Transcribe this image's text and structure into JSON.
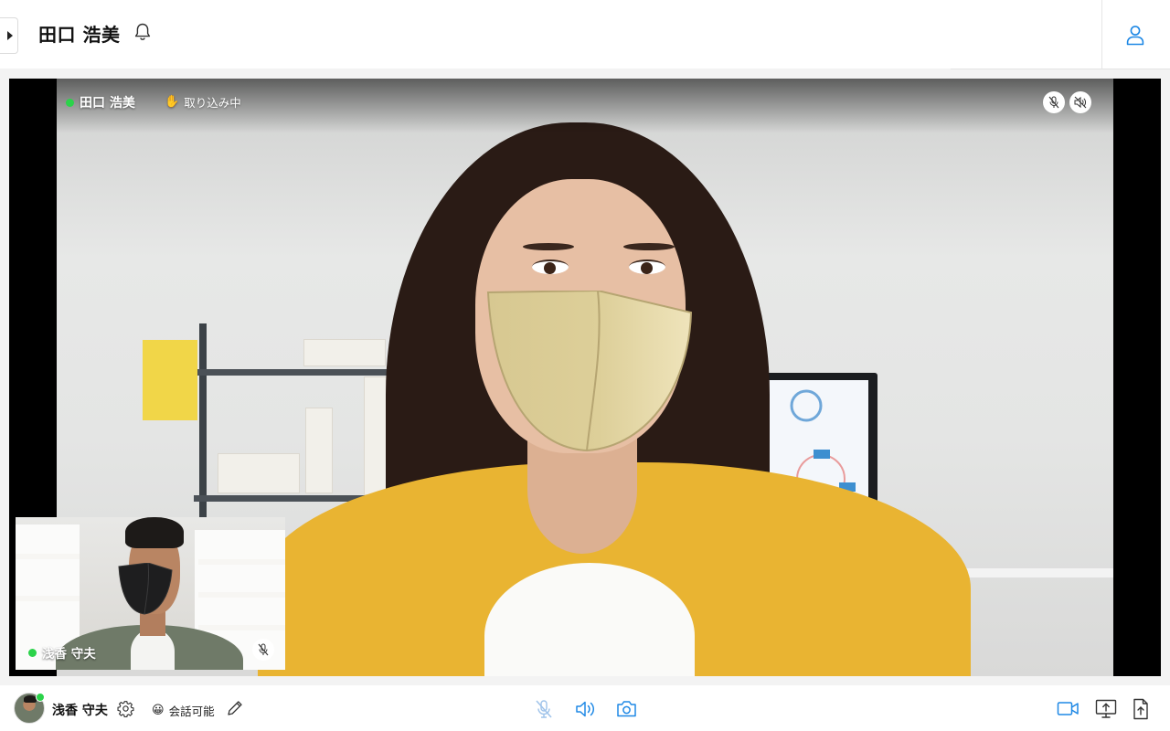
{
  "header": {
    "title": "田口 浩美"
  },
  "main_video": {
    "participant_name": "田口 浩美",
    "status_emoji": "✋",
    "status_text": "取り込み中"
  },
  "self_view": {
    "participant_name": "浅香 守夫"
  },
  "footer": {
    "user_name": "浅香 守夫",
    "status_emoji": "😀",
    "status_text": "会話可能"
  },
  "colors": {
    "accent": "#1e88e5",
    "online": "#2bd34a",
    "muted_icon": "#9fc3ea"
  }
}
